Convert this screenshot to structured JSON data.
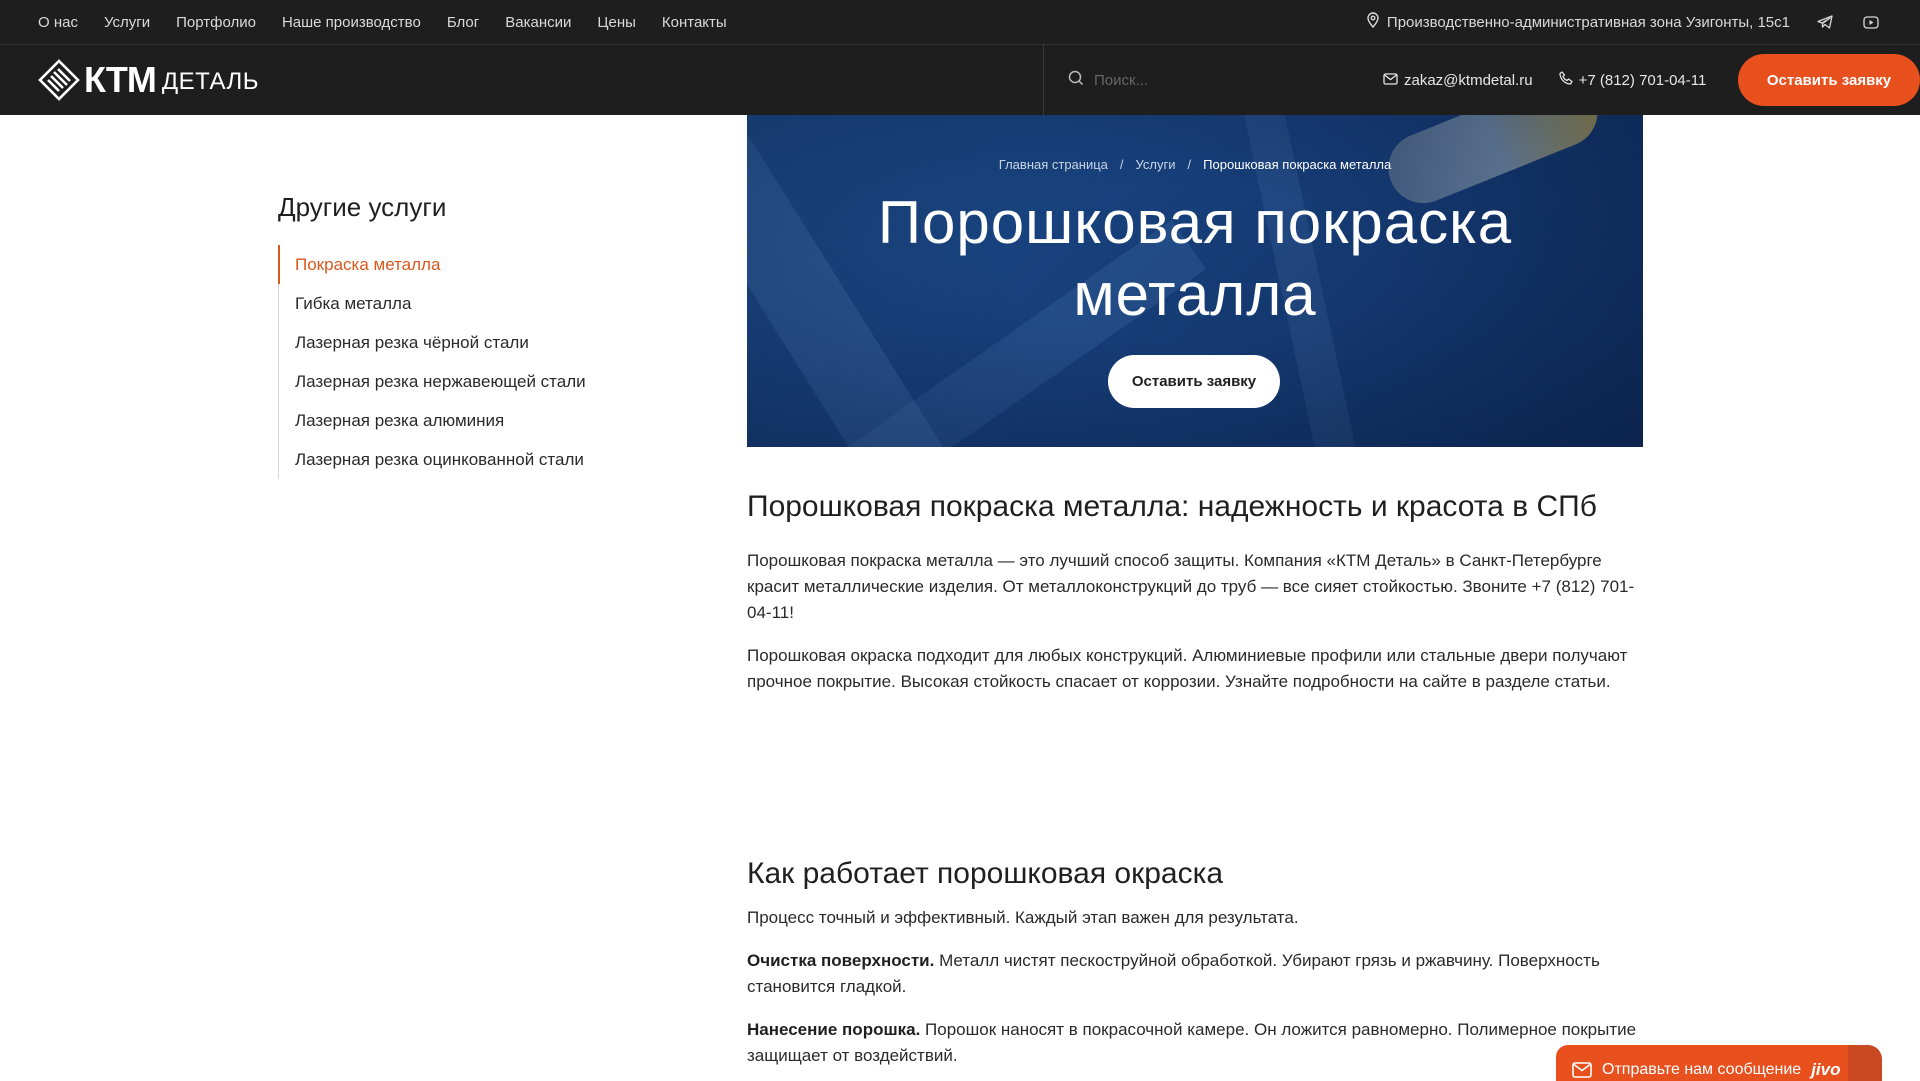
{
  "topbar": {
    "nav": [
      "О нас",
      "Услуги",
      "Портфолио",
      "Наше производство",
      "Блог",
      "Вакансии",
      "Цены",
      "Контакты"
    ],
    "address": "Производственно-административная зона Узигонты, 15с1"
  },
  "header": {
    "logo_main": "КТМ",
    "logo_sub": "ДЕТАЛЬ",
    "search_placeholder": "Поиск...",
    "email": "zakaz@ktmdetal.ru",
    "phone": "+7 (812) 701-04-11",
    "cta_label": "Оставить заявку"
  },
  "sidebar": {
    "title": "Другие услуги",
    "items": [
      {
        "label": "Покраска металла",
        "active": true
      },
      {
        "label": "Гибка металла",
        "active": false
      },
      {
        "label": "Лазерная резка чёрной стали",
        "active": false
      },
      {
        "label": "Лазерная резка нержавеющей стали",
        "active": false
      },
      {
        "label": "Лазерная резка алюминия",
        "active": false
      },
      {
        "label": "Лазерная резка оцинкованной стали",
        "active": false
      }
    ]
  },
  "hero": {
    "breadcrumb": [
      "Главная страница",
      "Услуги",
      "Порошковая покраска металла"
    ],
    "title_line1": "Порошковая покраска",
    "title_line2": "металла",
    "button_label": "Оставить заявку"
  },
  "content": {
    "title": "Порошковая покраска металла: надежность и красота в СПб",
    "p1": "Порошковая покраска металла — это лучший способ защиты. Компания «КТМ Деталь» в Санкт-Петербурге красит металлические изделия. От металлоконструкций до труб — все сияет стойкостью. Звоните +7 (812) 701-04-11!",
    "p2": "Порошковая окраска подходит для любых конструкций. Алюминиевые профили или стальные двери получают прочное покрытие. Высокая стойкость спасает от коррозии. Узнайте подробности на сайте в разделе статьи."
  },
  "section2": {
    "title": "Как работает порошковая окраска",
    "intro": "Процесс точный и эффективный. Каждый этап важен для результата.",
    "step1_bold": "Очистка поверхности.",
    "step1_text": " Металл чистят пескоструйной обработкой. Убирают грязь и ржавчину. Поверхность становится гладкой.",
    "step2_bold": "Нанесение порошка.",
    "step2_text": " Порошок наносят в покрасочной камере. Он ложится равномерно. Полимерное покрытие защищает от воздействий."
  },
  "chat": {
    "label": "Отправьте нам сообщение",
    "brand": "jivo"
  },
  "colors": {
    "accent": "#e8501e",
    "dark_bg": "#1e1e1e",
    "hero_blue": "#173f7a"
  }
}
